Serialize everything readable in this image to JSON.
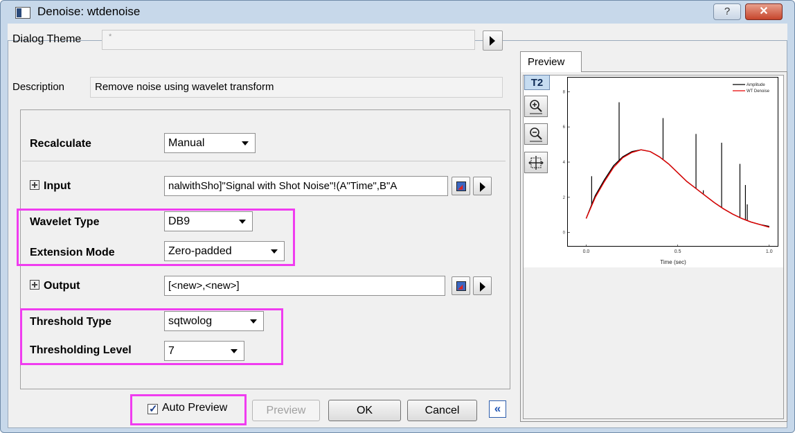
{
  "window": {
    "title": "Denoise: wtdenoise",
    "help_label": "?",
    "close_label": "✕"
  },
  "header": {
    "dialog_theme_label": "Dialog Theme",
    "dialog_theme_value": "*",
    "description_label": "Description",
    "description_value": "Remove noise using wavelet transform"
  },
  "settings": {
    "recalculate": {
      "label": "Recalculate",
      "value": "Manual"
    },
    "input": {
      "label": "Input",
      "value": "nalwithSho]\"Signal with Shot Noise\"!(A\"Time\",B\"A"
    },
    "wavelet_type": {
      "label": "Wavelet Type",
      "value": "DB9"
    },
    "extension_mode": {
      "label": "Extension Mode",
      "value": "Zero-padded"
    },
    "output": {
      "label": "Output",
      "value": "[<new>,<new>]"
    },
    "threshold_type": {
      "label": "Threshold Type",
      "value": "sqtwolog"
    },
    "thresholding_level": {
      "label": "Thresholding Level",
      "value": "7"
    }
  },
  "buttons": {
    "auto_preview_label": "Auto Preview",
    "auto_preview_checked": true,
    "preview": "Preview",
    "ok": "OK",
    "cancel": "Cancel",
    "collapse": "«"
  },
  "preview_panel": {
    "tab_label": "Preview",
    "toolbar_label": "T2",
    "tools": [
      "zoom-in-icon",
      "zoom-out-icon",
      "rescale-icon"
    ]
  },
  "chart_data": {
    "type": "line",
    "xlabel": "Time (sec)",
    "ylabel": "",
    "xlim": [
      -0.1,
      1.05
    ],
    "ylim": [
      -0.8,
      8.8
    ],
    "x_ticks": [
      "0.0",
      "0.5",
      "1.0"
    ],
    "y_ticks": [
      "0",
      "2",
      "4",
      "6",
      "8"
    ],
    "legend_position": "top-right",
    "series": [
      {
        "name": "Amplitude",
        "color": "#000000",
        "x": [
          0.0,
          0.05,
          0.1,
          0.15,
          0.2,
          0.25,
          0.3,
          0.35,
          0.4,
          0.45,
          0.5,
          0.55,
          0.6,
          0.65,
          0.7,
          0.75,
          0.8,
          0.85,
          0.9,
          0.95,
          1.0
        ],
        "y": [
          0.8,
          2.1,
          3.0,
          3.8,
          4.3,
          4.6,
          4.7,
          4.6,
          4.3,
          3.9,
          3.4,
          2.9,
          2.5,
          2.1,
          1.7,
          1.35,
          1.05,
          0.8,
          0.6,
          0.45,
          0.35
        ]
      },
      {
        "name": "WT Denoise",
        "color": "#e60000",
        "x": [
          0.0,
          0.05,
          0.1,
          0.15,
          0.2,
          0.25,
          0.3,
          0.35,
          0.4,
          0.45,
          0.5,
          0.55,
          0.6,
          0.65,
          0.7,
          0.75,
          0.8,
          0.85,
          0.9,
          0.95,
          1.0
        ],
        "y": [
          0.8,
          2.0,
          2.9,
          3.7,
          4.25,
          4.55,
          4.7,
          4.6,
          4.3,
          3.9,
          3.4,
          2.9,
          2.5,
          2.1,
          1.7,
          1.35,
          1.05,
          0.8,
          0.6,
          0.45,
          0.3
        ]
      }
    ],
    "spikes": [
      {
        "x": 0.03,
        "y": 3.2
      },
      {
        "x": 0.18,
        "y": 7.4
      },
      {
        "x": 0.42,
        "y": 6.5
      },
      {
        "x": 0.6,
        "y": 5.6
      },
      {
        "x": 0.64,
        "y": 2.4
      },
      {
        "x": 0.74,
        "y": 5.1
      },
      {
        "x": 0.84,
        "y": 3.9
      },
      {
        "x": 0.87,
        "y": 2.7
      },
      {
        "x": 0.88,
        "y": 1.6
      }
    ]
  }
}
